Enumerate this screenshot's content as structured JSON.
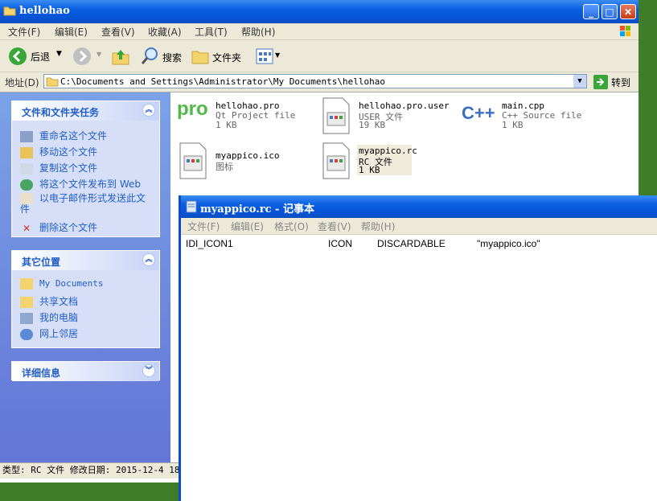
{
  "explorer": {
    "title": "hellohao",
    "menu": [
      "文件(F)",
      "编辑(E)",
      "查看(V)",
      "收藏(A)",
      "工具(T)",
      "帮助(H)"
    ],
    "toolbar": {
      "back": "后退",
      "search": "搜索",
      "folders": "文件夹"
    },
    "address": {
      "label": "地址(D)",
      "value": "C:\\Documents and Settings\\Administrator\\My Documents\\hellohao",
      "go": "转到"
    },
    "tasks_panel": {
      "title": "文件和文件夹任务",
      "items": [
        "重命名这个文件",
        "移动这个文件",
        "复制这个文件",
        "将这个文件发布到 Web",
        "以电子邮件形式发送此文件",
        "删除这个文件"
      ]
    },
    "places_panel": {
      "title": "其它位置",
      "items": [
        "My Documents",
        "共享文档",
        "我的电脑",
        "网上邻居"
      ]
    },
    "details_panel": {
      "title": "详细信息"
    },
    "files": [
      {
        "name": "hellohao.pro",
        "type": "Qt Project file",
        "size": "1 KB",
        "icon_text": "pro"
      },
      {
        "name": "hellohao.pro.user",
        "type": "USER 文件",
        "size": "19 KB"
      },
      {
        "name": "main.cpp",
        "type": "C++ Source file",
        "size": "1 KB",
        "icon_text": "C++"
      },
      {
        "name": "myappico.ico",
        "type": "图标",
        "size": ""
      },
      {
        "name": "myappico.rc",
        "type": "RC 文件",
        "size": "1 KB"
      }
    ],
    "status": "类型: RC 文件 修改日期: 2015-12-4 18:"
  },
  "notepad": {
    "title": "myappico.rc - 记事本",
    "menu": [
      "文件(F)",
      "编辑(E)",
      "格式(O)",
      "查看(V)",
      "帮助(H)"
    ],
    "content": {
      "c1": "IDI_ICON1",
      "c2": "ICON",
      "c3": "DISCARDABLE",
      "c4": "\"myappico.ico\""
    }
  },
  "colors": {
    "title_blue": "#0a5ee0",
    "task_link": "#215dc6",
    "chrome": "#ece9d8"
  }
}
